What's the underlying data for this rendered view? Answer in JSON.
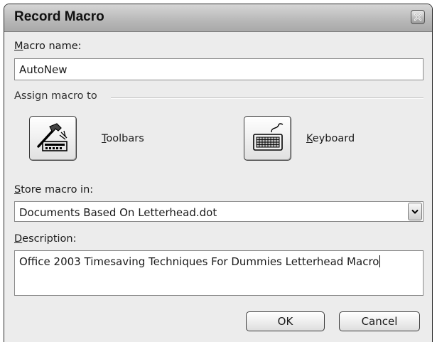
{
  "dialog": {
    "title": "Record Macro",
    "close_icon": "close-x-icon"
  },
  "macro_name": {
    "label_underline": "M",
    "label_rest": "acro name:",
    "value": "AutoNew"
  },
  "assign": {
    "group_label": "Assign macro to",
    "toolbars": {
      "icon": "hammer-toolbar-icon",
      "underline": "T",
      "rest": "oolbars"
    },
    "keyboard": {
      "icon": "keyboard-icon",
      "underline": "K",
      "rest": "eyboard"
    }
  },
  "store": {
    "label_underline": "S",
    "label_rest": "tore macro in:",
    "selected": "Documents Based On Letterhead.dot"
  },
  "description": {
    "label_underline": "D",
    "label_rest": "escription:",
    "value": "Office 2003 Timesaving Techniques For Dummies Letterhead Macro"
  },
  "buttons": {
    "ok": "OK",
    "cancel": "Cancel"
  }
}
